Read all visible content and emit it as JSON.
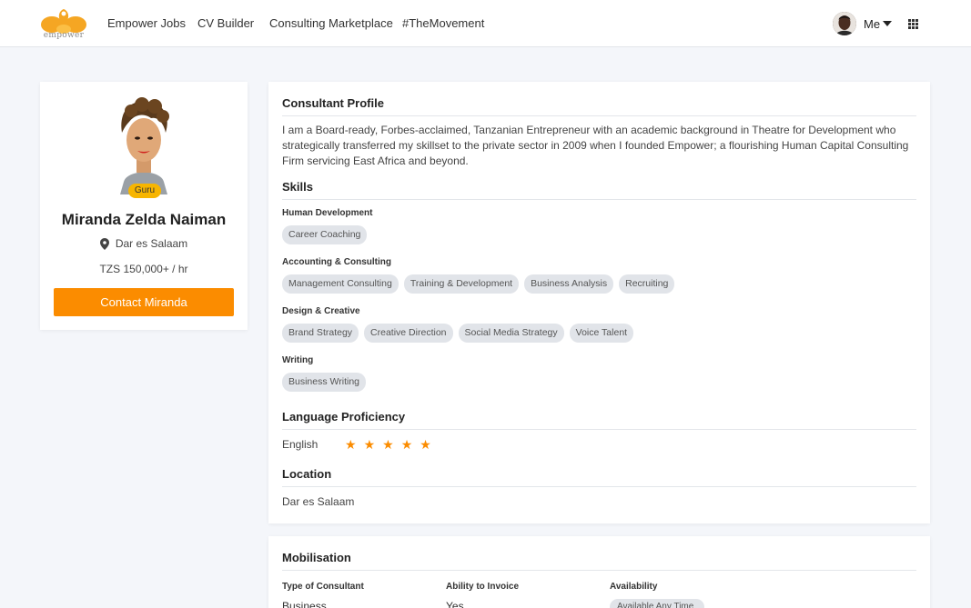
{
  "brand": {
    "name": "empower",
    "accent": "#fb8c00",
    "logo_color": "#f5a623"
  },
  "nav": {
    "links": [
      "Empower Jobs",
      "CV Builder",
      "Consulting Marketplace",
      "#TheMovement"
    ],
    "me_label": "Me",
    "apps_icon": "grid-icon"
  },
  "profile": {
    "badge": "Guru",
    "name": "Miranda Zelda Naiman",
    "location": "Dar es Salaam",
    "rate": "TZS 150,000+ / hr",
    "contact_label": "Contact Miranda"
  },
  "consultant_profile": {
    "title": "Consultant Profile",
    "bio": "I am a Board-ready, Forbes-acclaimed, Tanzanian Entrepreneur with an academic background in Theatre for Development who strategically transferred my skillset to the private sector in 2009 when I founded Empower; a flourishing Human Capital Consulting Firm servicing East Africa and beyond."
  },
  "skills": {
    "title": "Skills",
    "categories": [
      {
        "name": "Human Development",
        "items": [
          "Career Coaching"
        ]
      },
      {
        "name": "Accounting & Consulting",
        "items": [
          "Management Consulting",
          "Training & Development",
          "Business Analysis",
          "Recruiting"
        ]
      },
      {
        "name": "Design & Creative",
        "items": [
          "Brand Strategy",
          "Creative Direction",
          "Social Media Strategy",
          "Voice Talent"
        ]
      },
      {
        "name": "Writing",
        "items": [
          "Business Writing"
        ]
      }
    ]
  },
  "language": {
    "title": "Language Proficiency",
    "entries": [
      {
        "name": "English",
        "rating": 5,
        "max": 5
      }
    ]
  },
  "location_section": {
    "title": "Location",
    "value": "Dar es Salaam"
  },
  "mobilisation": {
    "title": "Mobilisation",
    "columns": [
      {
        "label": "Type of Consultant",
        "value": "Business"
      },
      {
        "label": "Ability to Invoice",
        "value": "Yes"
      },
      {
        "label": "Availability",
        "value": "Available Any Time"
      }
    ]
  }
}
